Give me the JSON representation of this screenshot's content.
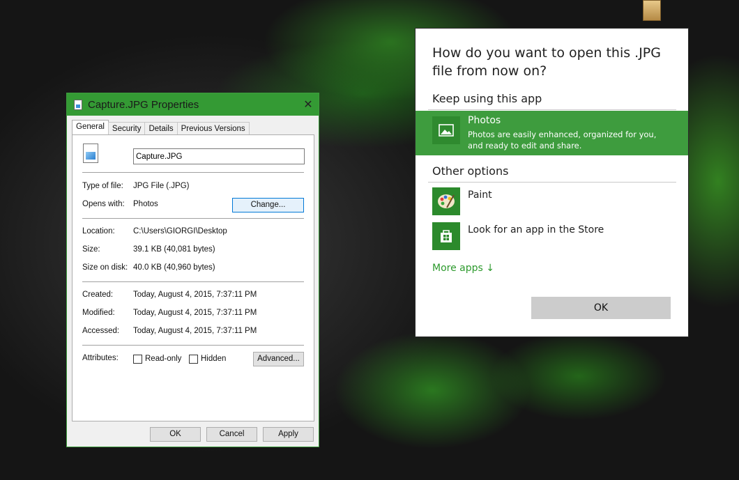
{
  "properties_dialog": {
    "title": "Capture.JPG Properties",
    "close_glyph": "✕",
    "tabs": [
      "General",
      "Security",
      "Details",
      "Previous Versions"
    ],
    "file_name": "Capture.JPG",
    "type_of_file_label": "Type of file:",
    "type_of_file": "JPG File (.JPG)",
    "opens_with_label": "Opens with:",
    "opens_with": "Photos",
    "change_button": "Change...",
    "location_label": "Location:",
    "location": "C:\\Users\\GIORGI\\Desktop",
    "size_label": "Size:",
    "size": "39.1 KB (40,081 bytes)",
    "size_on_disk_label": "Size on disk:",
    "size_on_disk": "40.0 KB (40,960 bytes)",
    "created_label": "Created:",
    "created": "Today, August 4, 2015, 7:37:11 PM",
    "modified_label": "Modified:",
    "modified": "Today, August 4, 2015, 7:37:11 PM",
    "accessed_label": "Accessed:",
    "accessed": "Today, August 4, 2015, 7:37:11 PM",
    "attributes_label": "Attributes:",
    "readonly_label": "Read-only",
    "hidden_label": "Hidden",
    "advanced_button": "Advanced...",
    "ok_button": "OK",
    "cancel_button": "Cancel",
    "apply_button": "Apply",
    "accent_color": "#349a34"
  },
  "open_with_dialog": {
    "heading": "How do you want to open this .JPG file from now on?",
    "keep_using_label": "Keep using this app",
    "photos_name": "Photos",
    "photos_desc": "Photos are easily enhanced, organized for you, and ready to edit and share.",
    "other_options_label": "Other options",
    "paint_name": "Paint",
    "store_name": "Look for an app in the Store",
    "more_apps": "More apps ↓",
    "ok_button": "OK",
    "selected_color": "#3e9c3e",
    "icons": [
      "photos-icon",
      "paint-icon",
      "store-icon"
    ]
  }
}
